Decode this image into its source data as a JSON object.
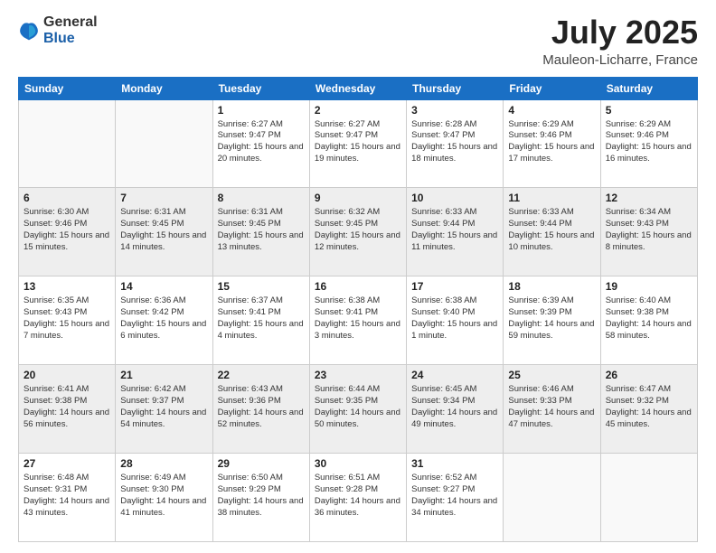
{
  "header": {
    "logo_general": "General",
    "logo_blue": "Blue",
    "month_title": "July 2025",
    "location": "Mauleon-Licharre, France"
  },
  "days_of_week": [
    "Sunday",
    "Monday",
    "Tuesday",
    "Wednesday",
    "Thursday",
    "Friday",
    "Saturday"
  ],
  "weeks": [
    [
      {
        "day": "",
        "sunrise": "",
        "sunset": "",
        "daylight": ""
      },
      {
        "day": "",
        "sunrise": "",
        "sunset": "",
        "daylight": ""
      },
      {
        "day": "1",
        "sunrise": "Sunrise: 6:27 AM",
        "sunset": "Sunset: 9:47 PM",
        "daylight": "Daylight: 15 hours and 20 minutes."
      },
      {
        "day": "2",
        "sunrise": "Sunrise: 6:27 AM",
        "sunset": "Sunset: 9:47 PM",
        "daylight": "Daylight: 15 hours and 19 minutes."
      },
      {
        "day": "3",
        "sunrise": "Sunrise: 6:28 AM",
        "sunset": "Sunset: 9:47 PM",
        "daylight": "Daylight: 15 hours and 18 minutes."
      },
      {
        "day": "4",
        "sunrise": "Sunrise: 6:29 AM",
        "sunset": "Sunset: 9:46 PM",
        "daylight": "Daylight: 15 hours and 17 minutes."
      },
      {
        "day": "5",
        "sunrise": "Sunrise: 6:29 AM",
        "sunset": "Sunset: 9:46 PM",
        "daylight": "Daylight: 15 hours and 16 minutes."
      }
    ],
    [
      {
        "day": "6",
        "sunrise": "Sunrise: 6:30 AM",
        "sunset": "Sunset: 9:46 PM",
        "daylight": "Daylight: 15 hours and 15 minutes."
      },
      {
        "day": "7",
        "sunrise": "Sunrise: 6:31 AM",
        "sunset": "Sunset: 9:45 PM",
        "daylight": "Daylight: 15 hours and 14 minutes."
      },
      {
        "day": "8",
        "sunrise": "Sunrise: 6:31 AM",
        "sunset": "Sunset: 9:45 PM",
        "daylight": "Daylight: 15 hours and 13 minutes."
      },
      {
        "day": "9",
        "sunrise": "Sunrise: 6:32 AM",
        "sunset": "Sunset: 9:45 PM",
        "daylight": "Daylight: 15 hours and 12 minutes."
      },
      {
        "day": "10",
        "sunrise": "Sunrise: 6:33 AM",
        "sunset": "Sunset: 9:44 PM",
        "daylight": "Daylight: 15 hours and 11 minutes."
      },
      {
        "day": "11",
        "sunrise": "Sunrise: 6:33 AM",
        "sunset": "Sunset: 9:44 PM",
        "daylight": "Daylight: 15 hours and 10 minutes."
      },
      {
        "day": "12",
        "sunrise": "Sunrise: 6:34 AM",
        "sunset": "Sunset: 9:43 PM",
        "daylight": "Daylight: 15 hours and 8 minutes."
      }
    ],
    [
      {
        "day": "13",
        "sunrise": "Sunrise: 6:35 AM",
        "sunset": "Sunset: 9:43 PM",
        "daylight": "Daylight: 15 hours and 7 minutes."
      },
      {
        "day": "14",
        "sunrise": "Sunrise: 6:36 AM",
        "sunset": "Sunset: 9:42 PM",
        "daylight": "Daylight: 15 hours and 6 minutes."
      },
      {
        "day": "15",
        "sunrise": "Sunrise: 6:37 AM",
        "sunset": "Sunset: 9:41 PM",
        "daylight": "Daylight: 15 hours and 4 minutes."
      },
      {
        "day": "16",
        "sunrise": "Sunrise: 6:38 AM",
        "sunset": "Sunset: 9:41 PM",
        "daylight": "Daylight: 15 hours and 3 minutes."
      },
      {
        "day": "17",
        "sunrise": "Sunrise: 6:38 AM",
        "sunset": "Sunset: 9:40 PM",
        "daylight": "Daylight: 15 hours and 1 minute."
      },
      {
        "day": "18",
        "sunrise": "Sunrise: 6:39 AM",
        "sunset": "Sunset: 9:39 PM",
        "daylight": "Daylight: 14 hours and 59 minutes."
      },
      {
        "day": "19",
        "sunrise": "Sunrise: 6:40 AM",
        "sunset": "Sunset: 9:38 PM",
        "daylight": "Daylight: 14 hours and 58 minutes."
      }
    ],
    [
      {
        "day": "20",
        "sunrise": "Sunrise: 6:41 AM",
        "sunset": "Sunset: 9:38 PM",
        "daylight": "Daylight: 14 hours and 56 minutes."
      },
      {
        "day": "21",
        "sunrise": "Sunrise: 6:42 AM",
        "sunset": "Sunset: 9:37 PM",
        "daylight": "Daylight: 14 hours and 54 minutes."
      },
      {
        "day": "22",
        "sunrise": "Sunrise: 6:43 AM",
        "sunset": "Sunset: 9:36 PM",
        "daylight": "Daylight: 14 hours and 52 minutes."
      },
      {
        "day": "23",
        "sunrise": "Sunrise: 6:44 AM",
        "sunset": "Sunset: 9:35 PM",
        "daylight": "Daylight: 14 hours and 50 minutes."
      },
      {
        "day": "24",
        "sunrise": "Sunrise: 6:45 AM",
        "sunset": "Sunset: 9:34 PM",
        "daylight": "Daylight: 14 hours and 49 minutes."
      },
      {
        "day": "25",
        "sunrise": "Sunrise: 6:46 AM",
        "sunset": "Sunset: 9:33 PM",
        "daylight": "Daylight: 14 hours and 47 minutes."
      },
      {
        "day": "26",
        "sunrise": "Sunrise: 6:47 AM",
        "sunset": "Sunset: 9:32 PM",
        "daylight": "Daylight: 14 hours and 45 minutes."
      }
    ],
    [
      {
        "day": "27",
        "sunrise": "Sunrise: 6:48 AM",
        "sunset": "Sunset: 9:31 PM",
        "daylight": "Daylight: 14 hours and 43 minutes."
      },
      {
        "day": "28",
        "sunrise": "Sunrise: 6:49 AM",
        "sunset": "Sunset: 9:30 PM",
        "daylight": "Daylight: 14 hours and 41 minutes."
      },
      {
        "day": "29",
        "sunrise": "Sunrise: 6:50 AM",
        "sunset": "Sunset: 9:29 PM",
        "daylight": "Daylight: 14 hours and 38 minutes."
      },
      {
        "day": "30",
        "sunrise": "Sunrise: 6:51 AM",
        "sunset": "Sunset: 9:28 PM",
        "daylight": "Daylight: 14 hours and 36 minutes."
      },
      {
        "day": "31",
        "sunrise": "Sunrise: 6:52 AM",
        "sunset": "Sunset: 9:27 PM",
        "daylight": "Daylight: 14 hours and 34 minutes."
      },
      {
        "day": "",
        "sunrise": "",
        "sunset": "",
        "daylight": ""
      },
      {
        "day": "",
        "sunrise": "",
        "sunset": "",
        "daylight": ""
      }
    ]
  ]
}
